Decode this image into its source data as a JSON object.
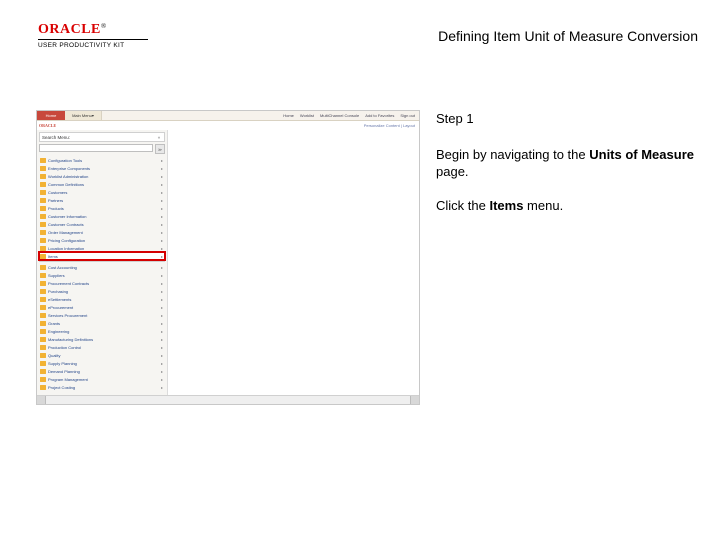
{
  "brand": {
    "name": "ORACLE",
    "sub": "USER PRODUCTIVITY KIT"
  },
  "doc_title": "Defining Item Unit of Measure Conversion",
  "step": {
    "label": "Step 1",
    "p1_a": "Begin by navigating to the ",
    "p1_b": "Units of Measure",
    "p1_c": " page.",
    "p2_a": "Click the ",
    "p2_b": "Items",
    "p2_c": " menu."
  },
  "mini": {
    "tabs": {
      "home": "Home",
      "main_menu": "Main Menu"
    },
    "linkbar": [
      "Home",
      "Worklist",
      "MultiChannel Console",
      "Add to Favorites",
      "Sign out"
    ],
    "logo": "ORACLE",
    "rightlinks": "Personalize Content | Layout",
    "nav_title": "Search Menu:",
    "search_placeholder": "",
    "highlight_index": 12,
    "items": [
      "Configuration Tools",
      "Enterprise Components",
      "Worklist Administration",
      "Common Definitions",
      "Customers",
      "Partners",
      "Products",
      "Customer Information",
      "Customer Contracts",
      "Order Management",
      "Pricing Configuration",
      "Location Information",
      "Items",
      "Cost Accounting",
      "Suppliers",
      "Procurement Contracts",
      "Purchasing",
      "eSettlements",
      "eProcurement",
      "Services Procurement",
      "Grants",
      "Engineering",
      "Manufacturing Definitions",
      "Production Control",
      "Quality",
      "Supply Planning",
      "Demand Planning",
      "Program Management",
      "Project Costing"
    ]
  }
}
